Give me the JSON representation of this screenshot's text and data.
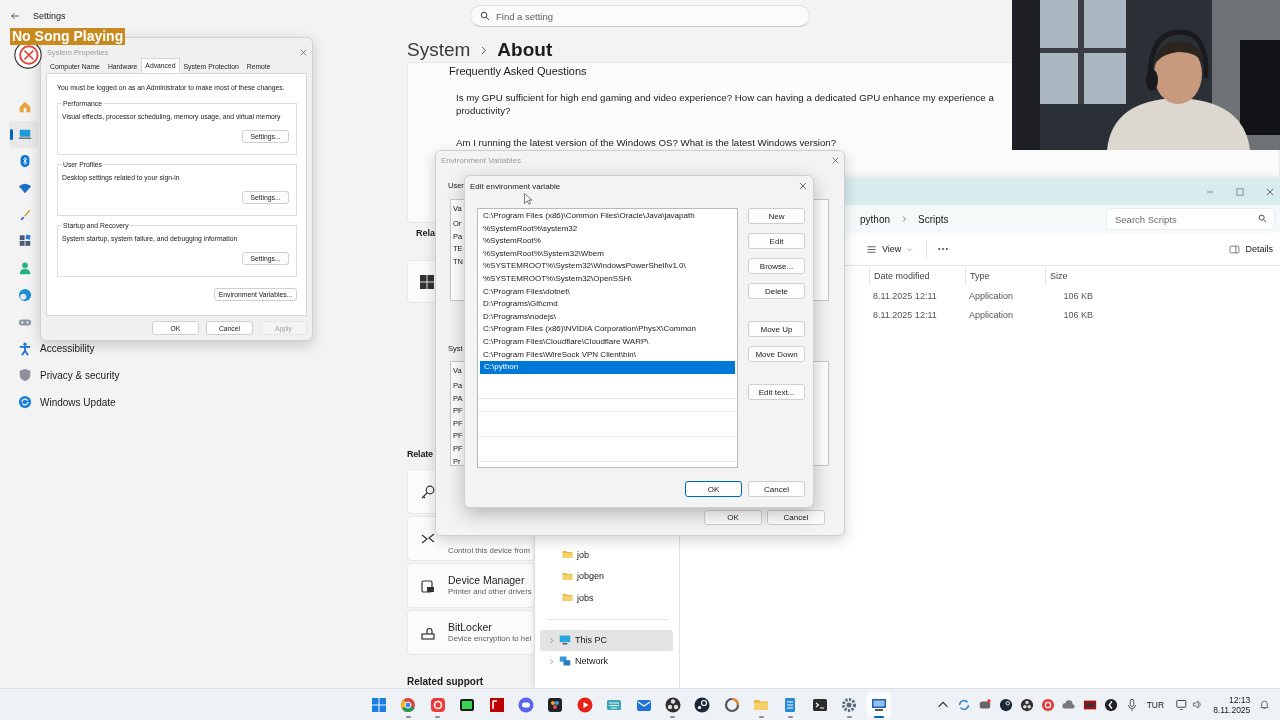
{
  "settings": {
    "title": "Settings",
    "search": {
      "placeholder": "Find a setting"
    },
    "breadcrumb": [
      "System",
      "About"
    ],
    "nav": [
      {
        "kind": "home",
        "selected": false
      },
      {
        "kind": "system",
        "selected": true
      },
      {
        "kind": "bluetooth",
        "selected": false
      },
      {
        "kind": "network",
        "selected": false
      },
      {
        "kind": "personalize",
        "selected": false
      },
      {
        "kind": "apps",
        "selected": false
      },
      {
        "kind": "accounts",
        "selected": false
      },
      {
        "kind": "time",
        "selected": false
      },
      {
        "kind": "gaming",
        "selected": false
      },
      {
        "kind": "accessibility",
        "label": "Accessibility",
        "selected": false
      },
      {
        "kind": "privacy",
        "label": "Privacy & security",
        "selected": false
      },
      {
        "kind": "update",
        "label": "Windows Update",
        "selected": false
      }
    ],
    "faq": {
      "heading": "Frequently Asked Questions",
      "questions": [
        {
          "lines": [
            "Is my GPU sufficient for high end gaming and video experience? How can having a dedicated GPU enhance my experience a",
            "productivity?"
          ]
        },
        {
          "lines": [
            "Am I running the latest version of the Windows OS? What is the latest Windows version?"
          ]
        }
      ]
    },
    "related_cut": "Rela",
    "related_heading": "Relate",
    "related": [
      {
        "kind": "key"
      },
      {
        "kind": "remote",
        "description": "Control this device from"
      },
      {
        "kind": "device",
        "title": "Device Manager",
        "description": "Printer and other drivers"
      },
      {
        "kind": "lock",
        "title": "BitLocker",
        "description": "Device encryption to hel"
      }
    ],
    "support_heading": "Related support"
  },
  "now_playing": "No Song Playing",
  "system_properties": {
    "title": "System Properties",
    "tabs": [
      {
        "label": "Computer Name",
        "selected": false
      },
      {
        "label": "Hardware",
        "selected": false
      },
      {
        "label": "Advanced",
        "selected": true
      },
      {
        "label": "System Protection",
        "selected": false
      },
      {
        "label": "Remote",
        "selected": false
      }
    ],
    "note": "You must be logged on as an Administrator to make most of these changes.",
    "groups": [
      {
        "title": "Performance",
        "description": "Visual effects, processor scheduling, memory usage, and virtual memory",
        "button": "Settings..."
      },
      {
        "title": "User Profiles",
        "description": "Desktop settings related to your sign-in",
        "button": "Settings..."
      },
      {
        "title": "Startup and Recovery",
        "description": "System startup, system failure, and debugging information",
        "button": "Settings..."
      }
    ],
    "env_button": "Environment Variables...",
    "buttons": [
      {
        "label": "OK",
        "disabled": false
      },
      {
        "label": "Cancel",
        "disabled": false
      },
      {
        "label": "Apply",
        "disabled": true
      }
    ]
  },
  "environment_variables": {
    "title": "Environment Variables",
    "user_label": "User",
    "user_rows": [
      "Va",
      "Or",
      "Pa",
      "TE",
      "TN"
    ],
    "system_label": "Syst",
    "system_rows": [
      "Va",
      "Pa",
      "PA",
      "PF",
      "PF",
      "PF",
      "PF",
      "Pr"
    ],
    "buttons": [
      "OK",
      "Cancel"
    ]
  },
  "edit_variable": {
    "title": "Edit environment variable",
    "paths": [
      {
        "text": "C:\\Program Files (x86)\\Common Files\\Oracle\\Java\\javapath",
        "selected": false
      },
      {
        "text": "%SystemRoot%\\system32",
        "selected": false
      },
      {
        "text": "%SystemRoot%",
        "selected": false
      },
      {
        "text": "%SystemRoot%\\System32\\Wbem",
        "selected": false
      },
      {
        "text": "%SYSTEMROOT%\\System32\\WindowsPowerShell\\v1.0\\",
        "selected": false
      },
      {
        "text": "%SYSTEMROOT%\\System32\\OpenSSH\\",
        "selected": false
      },
      {
        "text": "C:\\Program Files\\dotnet\\",
        "selected": false
      },
      {
        "text": "D:\\Programs\\Git\\cmd",
        "selected": false
      },
      {
        "text": "D:\\Programs\\nodejs\\",
        "selected": false
      },
      {
        "text": "C:\\Program Files (x86)\\NVIDIA Corporation\\PhysX\\Common",
        "selected": false
      },
      {
        "text": "C:\\Program Files\\Cloudflare\\Cloudflare WARP\\",
        "selected": false
      },
      {
        "text": "C:\\Program Files\\WireSock VPN Client\\bin\\",
        "selected": false
      },
      {
        "text": "C:\\python",
        "selected": true
      }
    ],
    "side_button_groups": [
      [
        "New",
        "Edit",
        "Browse...",
        "Delete"
      ],
      [
        "Move Up",
        "Move Down"
      ],
      [
        "Edit text..."
      ]
    ],
    "buttons": [
      "OK",
      "Cancel"
    ]
  },
  "explorer": {
    "breadcrumb": [
      "python",
      "Scripts"
    ],
    "search": {
      "placeholder": "Search Scripts"
    },
    "view": "View",
    "details": "Details",
    "columns": [
      "Date modified",
      "Type",
      "Size"
    ],
    "rows": [
      {
        "date": "8.11.2025 12:11",
        "type": "Application",
        "size": "106 KB"
      },
      {
        "date": "8.11.2025 12:11",
        "type": "Application",
        "size": "106 KB"
      }
    ],
    "folders": [
      {
        "label": "job",
        "selected": false
      },
      {
        "label": "jobgen",
        "selected": false
      },
      {
        "label": "jobs",
        "selected": false
      }
    ],
    "locations": [
      {
        "kind": "pc",
        "label": "This PC",
        "selected": true
      },
      {
        "kind": "network",
        "label": "Network",
        "selected": false
      }
    ]
  },
  "taskbar": {
    "apps": [
      {
        "kind": "start",
        "running": false,
        "active": false
      },
      {
        "kind": "ring",
        "running": true,
        "active": false
      },
      {
        "kind": "redapp",
        "running": true,
        "active": false
      },
      {
        "kind": "console",
        "running": false,
        "active": false
      },
      {
        "kind": "ftp",
        "running": false,
        "active": false
      },
      {
        "kind": "chat",
        "running": false,
        "active": false
      },
      {
        "kind": "editor",
        "running": false,
        "active": false
      },
      {
        "kind": "player",
        "running": false,
        "active": false
      },
      {
        "kind": "keyboard",
        "running": false,
        "active": false
      },
      {
        "kind": "mail",
        "running": false,
        "active": false
      },
      {
        "kind": "recorder",
        "running": true,
        "active": false
      },
      {
        "kind": "steam",
        "running": false,
        "active": false
      },
      {
        "kind": "spinner",
        "running": false,
        "active": false
      },
      {
        "kind": "folder",
        "running": true,
        "active": false
      },
      {
        "kind": "notes",
        "running": true,
        "active": false
      },
      {
        "kind": "terminal",
        "running": false,
        "active": false
      },
      {
        "kind": "gear",
        "running": true,
        "active": false
      },
      {
        "kind": "system",
        "running": true,
        "active": true
      }
    ],
    "language": "TUR",
    "time": "12:13",
    "date": "8.11.2025"
  }
}
